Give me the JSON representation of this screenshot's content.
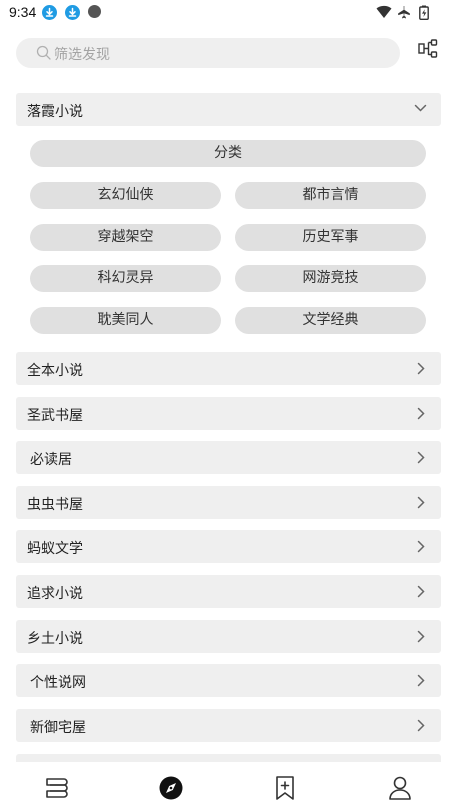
{
  "status": {
    "time": "9:34"
  },
  "search": {
    "placeholder": "筛选发现"
  },
  "group": {
    "title": "落霞小说",
    "category_label": "分类",
    "categories": [
      "玄幻仙侠",
      "都市言情",
      "穿越架空",
      "历史军事",
      "科幻灵异",
      "网游竞技",
      "耽美同人",
      "文学经典"
    ]
  },
  "sources": [
    {
      "label": "全本小说"
    },
    {
      "label": "圣武书屋"
    },
    {
      "label": "必读居"
    },
    {
      "label": "虫虫书屋"
    },
    {
      "label": "蚂蚁文学"
    },
    {
      "label": "追求小说"
    },
    {
      "label": "乡土小说"
    },
    {
      "label": "个性说网"
    },
    {
      "label": "新御宅屋"
    }
  ],
  "colors": {
    "accent_blue": "#1f9be3",
    "row_bg": "#efefef",
    "pill_bg": "#e0e0e0"
  }
}
